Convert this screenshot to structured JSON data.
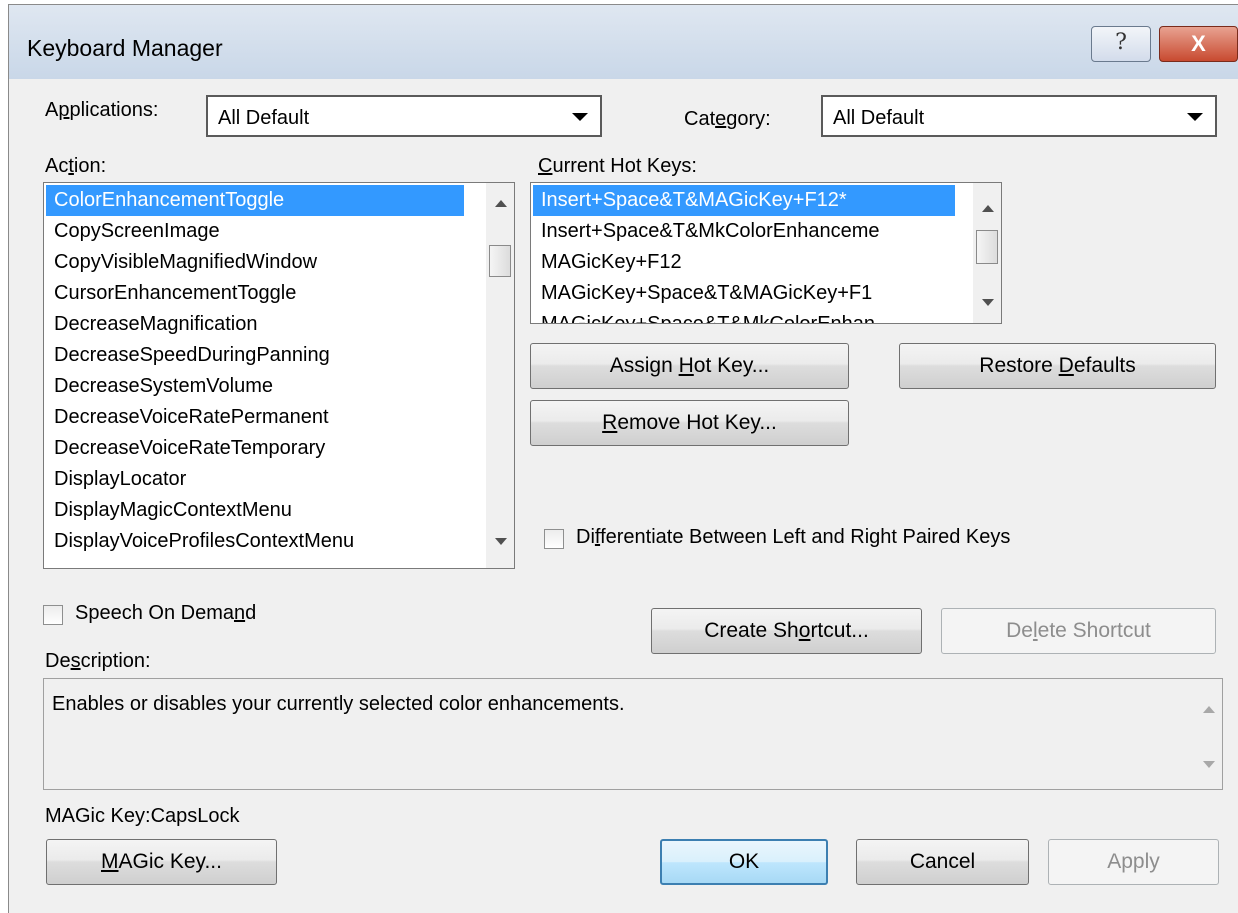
{
  "window": {
    "title": "Keyboard Manager",
    "help_glyph": "?",
    "close_glyph": "X"
  },
  "applications": {
    "label_pre": "A",
    "label_ul": "p",
    "label_post": "plications:",
    "value": "All Default"
  },
  "category": {
    "label_pre": "Cat",
    "label_ul": "e",
    "label_post": "gory:",
    "value": "All Default"
  },
  "action": {
    "label_pre": "Ac",
    "label_ul": "t",
    "label_post": "ion:",
    "items": [
      "ColorEnhancementToggle",
      "CopyScreenImage",
      "CopyVisibleMagnifiedWindow",
      "CursorEnhancementToggle",
      "DecreaseMagnification",
      "DecreaseSpeedDuringPanning",
      "DecreaseSystemVolume",
      "DecreaseVoiceRatePermanent",
      "DecreaseVoiceRateTemporary",
      "DisplayLocator",
      "DisplayMagicContextMenu",
      "DisplayVoiceProfilesContextMenu"
    ]
  },
  "hotkeys": {
    "label_pre": "",
    "label_ul": "C",
    "label_post": "urrent Hot Keys:",
    "items": [
      "Insert+Space&T&MAGicKey+F12*",
      "Insert+Space&T&MkColorEnhanceme",
      "MAGicKey+F12",
      "MAGicKey+Space&T&MAGicKey+F1",
      "MAGicKey+Space&T&MkColorEnhan"
    ]
  },
  "buttons": {
    "assign_pre": "Assign ",
    "assign_ul": "H",
    "assign_post": "ot Key...",
    "remove_pre": "",
    "remove_ul": "R",
    "remove_post": "emove Hot Key...",
    "restore_pre": "Restore ",
    "restore_ul": "D",
    "restore_post": "efaults",
    "create_pre": "Create Sh",
    "create_ul": "o",
    "create_post": "rtcut...",
    "delete_pre": "De",
    "delete_ul": "l",
    "delete_post": "ete Shortcut",
    "magic_pre": "",
    "magic_ul": "M",
    "magic_post": "AGic Key...",
    "ok": "OK",
    "cancel": "Cancel",
    "apply": "Apply"
  },
  "differentiate": {
    "label_pre": "Di",
    "label_ul": "f",
    "label_post": "ferentiate Between Left and Right Paired Keys",
    "checked": false
  },
  "speech": {
    "label_pre": "Speech On Dema",
    "label_ul": "n",
    "label_post": "d",
    "checked": false
  },
  "description": {
    "label_pre": "De",
    "label_ul": "s",
    "label_post": "cription:",
    "text": "Enables or disables your currently selected color enhancements."
  },
  "magic_key_status": "MAGic Key:CapsLock",
  "colors": {
    "selection": "#3399ff",
    "dialog_bg": "#f0f0f0",
    "close_button": "#c84a30"
  }
}
